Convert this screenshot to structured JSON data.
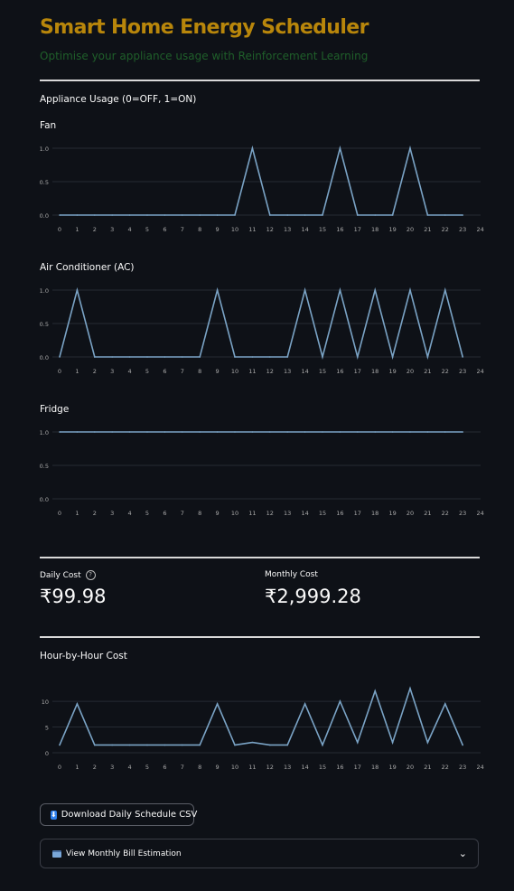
{
  "header": {
    "title": "Smart Home Energy Scheduler",
    "subtitle": "Optimise your appliance usage with Reinforcement Learning"
  },
  "usage": {
    "label": "Appliance Usage (0=OFF, 1=ON)"
  },
  "colors": {
    "title": "#b8860b",
    "subtitle": "#1f5f2a",
    "line": "#7aa3c5",
    "background": "#0e1117"
  },
  "chart_data": [
    {
      "type": "line",
      "title": "Fan",
      "x": [
        0,
        1,
        2,
        3,
        4,
        5,
        6,
        7,
        8,
        9,
        10,
        11,
        12,
        13,
        14,
        15,
        16,
        17,
        18,
        19,
        20,
        21,
        22,
        23
      ],
      "values": [
        0,
        0,
        0,
        0,
        0,
        0,
        0,
        0,
        0,
        0,
        0,
        1,
        0,
        0,
        0,
        0,
        1,
        0,
        0,
        0,
        1,
        0,
        0,
        0
      ],
      "ylim": [
        0,
        1
      ],
      "yticks": [
        "0.0",
        "0.5",
        "1.0"
      ],
      "xticks": [
        "0",
        "1",
        "2",
        "3",
        "4",
        "5",
        "6",
        "7",
        "8",
        "9",
        "10",
        "11",
        "12",
        "13",
        "14",
        "15",
        "16",
        "17",
        "18",
        "19",
        "20",
        "21",
        "22",
        "23",
        "24"
      ],
      "grid": true
    },
    {
      "type": "line",
      "title": "Air Conditioner (AC)",
      "x": [
        0,
        1,
        2,
        3,
        4,
        5,
        6,
        7,
        8,
        9,
        10,
        11,
        12,
        13,
        14,
        15,
        16,
        17,
        18,
        19,
        20,
        21,
        22,
        23
      ],
      "values": [
        0,
        1,
        0,
        0,
        0,
        0,
        0,
        0,
        0,
        1,
        0,
        0,
        0,
        0,
        1,
        0,
        1,
        0,
        1,
        0,
        1,
        0,
        1,
        0
      ],
      "ylim": [
        0,
        1
      ],
      "yticks": [
        "0.0",
        "0.5",
        "1.0"
      ],
      "xticks": [
        "0",
        "1",
        "2",
        "3",
        "4",
        "5",
        "6",
        "7",
        "8",
        "9",
        "10",
        "11",
        "12",
        "13",
        "14",
        "15",
        "16",
        "17",
        "18",
        "19",
        "20",
        "21",
        "22",
        "23",
        "24"
      ],
      "grid": true
    },
    {
      "type": "line",
      "title": "Fridge",
      "x": [
        0,
        1,
        2,
        3,
        4,
        5,
        6,
        7,
        8,
        9,
        10,
        11,
        12,
        13,
        14,
        15,
        16,
        17,
        18,
        19,
        20,
        21,
        22,
        23
      ],
      "values": [
        1,
        1,
        1,
        1,
        1,
        1,
        1,
        1,
        1,
        1,
        1,
        1,
        1,
        1,
        1,
        1,
        1,
        1,
        1,
        1,
        1,
        1,
        1,
        1
      ],
      "ylim": [
        0,
        1
      ],
      "yticks": [
        "0.0",
        "0.5",
        "1.0"
      ],
      "xticks": [
        "0",
        "1",
        "2",
        "3",
        "4",
        "5",
        "6",
        "7",
        "8",
        "9",
        "10",
        "11",
        "12",
        "13",
        "14",
        "15",
        "16",
        "17",
        "18",
        "19",
        "20",
        "21",
        "22",
        "23",
        "24"
      ],
      "grid": true
    },
    {
      "type": "line",
      "title": "Hour-by-Hour Cost",
      "x": [
        0,
        1,
        2,
        3,
        4,
        5,
        6,
        7,
        8,
        9,
        10,
        11,
        12,
        13,
        14,
        15,
        16,
        17,
        18,
        19,
        20,
        21,
        22,
        23
      ],
      "values": [
        1.5,
        9.5,
        1.5,
        1.5,
        1.5,
        1.5,
        1.5,
        1.5,
        1.5,
        9.5,
        1.5,
        2,
        1.5,
        1.5,
        9.5,
        1.5,
        10,
        2,
        12,
        2,
        12.5,
        2,
        9.5,
        1.5
      ],
      "ylim": [
        0,
        13
      ],
      "yticks": [
        "0",
        "5",
        "10"
      ],
      "xticks": [
        "0",
        "1",
        "2",
        "3",
        "4",
        "5",
        "6",
        "7",
        "8",
        "9",
        "10",
        "11",
        "12",
        "13",
        "14",
        "15",
        "16",
        "17",
        "18",
        "19",
        "20",
        "21",
        "22",
        "23",
        "24"
      ],
      "grid": true
    }
  ],
  "metrics": {
    "daily_label": "Daily Cost",
    "daily_value": "₹99.98",
    "monthly_label": "Monthly Cost",
    "monthly_value": "₹2,999.28",
    "help_icon": "question-circle-icon"
  },
  "download_button": {
    "label": "Download Daily Schedule CSV",
    "icon": "download-icon"
  },
  "expander": {
    "label": "View Monthly Bill Estimation",
    "icon": "credit-card-icon",
    "chevron": "chevron-down-icon"
  }
}
